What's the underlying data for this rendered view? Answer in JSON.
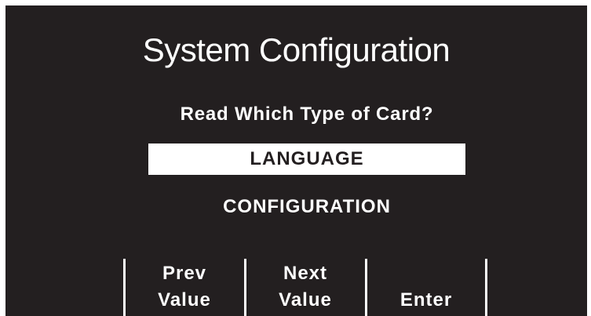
{
  "screen": {
    "title": "System Configuration",
    "prompt": "Read Which Type of Card?",
    "options": [
      {
        "label": "LANGUAGE",
        "selected": true
      },
      {
        "label": "CONFIGURATION",
        "selected": false
      }
    ],
    "softkeys": [
      {
        "line1": "Prev",
        "line2": "Value"
      },
      {
        "line1": "Next",
        "line2": "Value"
      },
      {
        "line1": "",
        "line2": "Enter"
      }
    ]
  },
  "colors": {
    "background": "#231f20",
    "text": "#ffffff",
    "highlight": "#ffffff"
  }
}
